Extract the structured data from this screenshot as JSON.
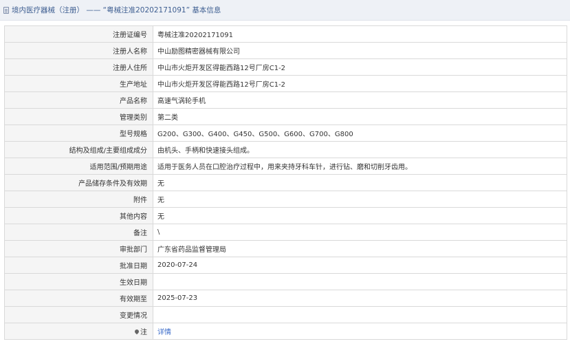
{
  "header": {
    "title": "境内医疗器械（注册） —— “粤械注准20202171091” 基本信息",
    "icon": "document-icon"
  },
  "rows": [
    {
      "label": "注册证编号",
      "value": "粤械注准20202171091"
    },
    {
      "label": "注册人名称",
      "value": "中山励图精密器械有限公司"
    },
    {
      "label": "注册人住所",
      "value": "中山市火炬开发区得能西路12号厂房C1-2"
    },
    {
      "label": "生产地址",
      "value": "中山市火炬开发区得能西路12号厂房C1-2"
    },
    {
      "label": "产品名称",
      "value": "高速气涡轮手机"
    },
    {
      "label": "管理类别",
      "value": "第二类"
    },
    {
      "label": "型号规格",
      "value": "G200、G300、G400、G450、G500、G600、G700、G800"
    },
    {
      "label": "结构及组成/主要组成成分",
      "value": "由机头、手柄和快速接头组成。"
    },
    {
      "label": "适用范围/预期用途",
      "value": "适用于医务人员在口腔治疗过程中，用来夹持牙科车针，进行钻、磨和切削牙齿用。"
    },
    {
      "label": "产品储存条件及有效期",
      "value": "无"
    },
    {
      "label": "附件",
      "value": "无"
    },
    {
      "label": "其他内容",
      "value": "无"
    },
    {
      "label": "备注",
      "value": "\\"
    },
    {
      "label": "审批部门",
      "value": "广东省药品监督管理局"
    },
    {
      "label": "批准日期",
      "value": "2020-07-24"
    },
    {
      "label": "生效日期",
      "value": ""
    },
    {
      "label": "有效期至",
      "value": "2025-07-23"
    },
    {
      "label": "变更情况",
      "value": ""
    }
  ],
  "note_row": {
    "icon": "pin-icon",
    "label": "注",
    "link_text": "详情"
  }
}
